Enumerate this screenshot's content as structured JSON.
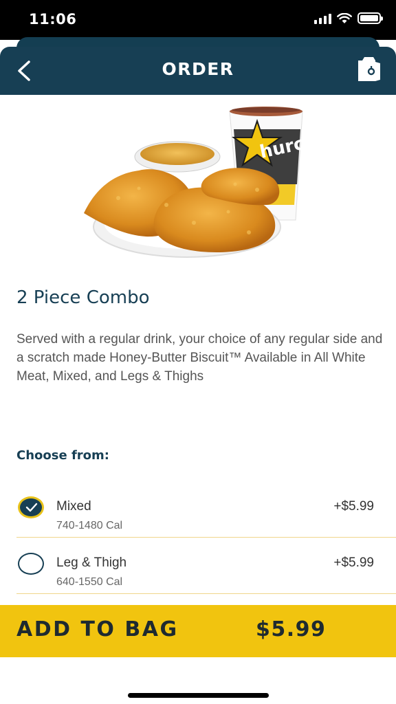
{
  "status_bar": {
    "time": "11:06"
  },
  "header": {
    "title": "ORDER",
    "back_icon": "chevron-left-icon",
    "bag_icon": "bag-icon"
  },
  "product": {
    "title": "2 Piece Combo",
    "description": "Served with a regular drink, your choice of any regular side and a scratch made Honey-Butter Biscuit™ Available in All White Meat, Mixed, and Legs & Thighs",
    "image_brand_text": "hurch's"
  },
  "choose": {
    "label": "Choose from:",
    "options": [
      {
        "name": "Mixed",
        "calories": "740-1480 Cal",
        "price": "+$5.99",
        "selected": true
      },
      {
        "name": "Leg & Thigh",
        "calories": "640-1550 Cal",
        "price": "+$5.99",
        "selected": false
      }
    ]
  },
  "add_to_bag": {
    "label": "ADD TO BAG",
    "price": "$5.99"
  },
  "colors": {
    "navy": "#173f54",
    "yellow": "#f1c40f"
  }
}
